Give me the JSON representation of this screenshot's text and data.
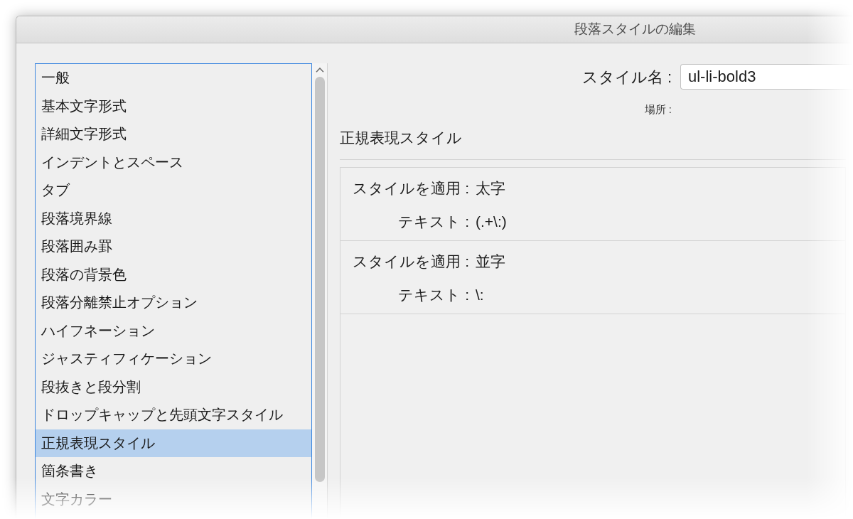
{
  "window": {
    "title": "段落スタイルの編集"
  },
  "sidebar": {
    "items": [
      {
        "label": "一般",
        "selected": false
      },
      {
        "label": "基本文字形式",
        "selected": false
      },
      {
        "label": "詳細文字形式",
        "selected": false
      },
      {
        "label": "インデントとスペース",
        "selected": false
      },
      {
        "label": "タブ",
        "selected": false
      },
      {
        "label": "段落境界線",
        "selected": false
      },
      {
        "label": "段落囲み罫",
        "selected": false
      },
      {
        "label": "段落の背景色",
        "selected": false
      },
      {
        "label": "段落分離禁止オプション",
        "selected": false
      },
      {
        "label": "ハイフネーション",
        "selected": false
      },
      {
        "label": "ジャスティフィケーション",
        "selected": false
      },
      {
        "label": "段抜きと段分割",
        "selected": false
      },
      {
        "label": "ドロップキャップと先頭文字スタイル",
        "selected": false
      },
      {
        "label": "正規表現スタイル",
        "selected": true
      },
      {
        "label": "箇条書き",
        "selected": false
      },
      {
        "label": "文字カラー",
        "selected": false
      }
    ]
  },
  "style_name": {
    "label": "スタイル名 :",
    "value": "ul-li-bold3"
  },
  "location": {
    "label": "場所 :"
  },
  "section": {
    "title": "正規表現スタイル"
  },
  "regex_styles": [
    {
      "apply_label": "スタイルを適用 :",
      "apply_value": "太字",
      "text_label": "テキスト :",
      "text_value": "(.+\\:)"
    },
    {
      "apply_label": "スタイルを適用 :",
      "apply_value": "並字",
      "text_label": "テキスト :",
      "text_value": "\\:"
    }
  ]
}
